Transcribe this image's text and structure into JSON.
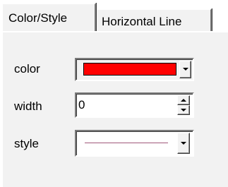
{
  "tabs": [
    {
      "label": "Color/Style",
      "active": true
    },
    {
      "label": "Horizontal Line",
      "active": false
    }
  ],
  "fields": {
    "color": {
      "label": "color",
      "value_color": "#ff0000"
    },
    "width": {
      "label": "width",
      "value": "0"
    },
    "style": {
      "label": "style",
      "line_color": "#a0587a"
    }
  },
  "icons": {
    "dropdown": "chevron-down-icon",
    "spin_up": "spin-up-icon",
    "spin_down": "spin-down-icon"
  },
  "colors": {
    "panel_bg": "#f2f2f2"
  }
}
